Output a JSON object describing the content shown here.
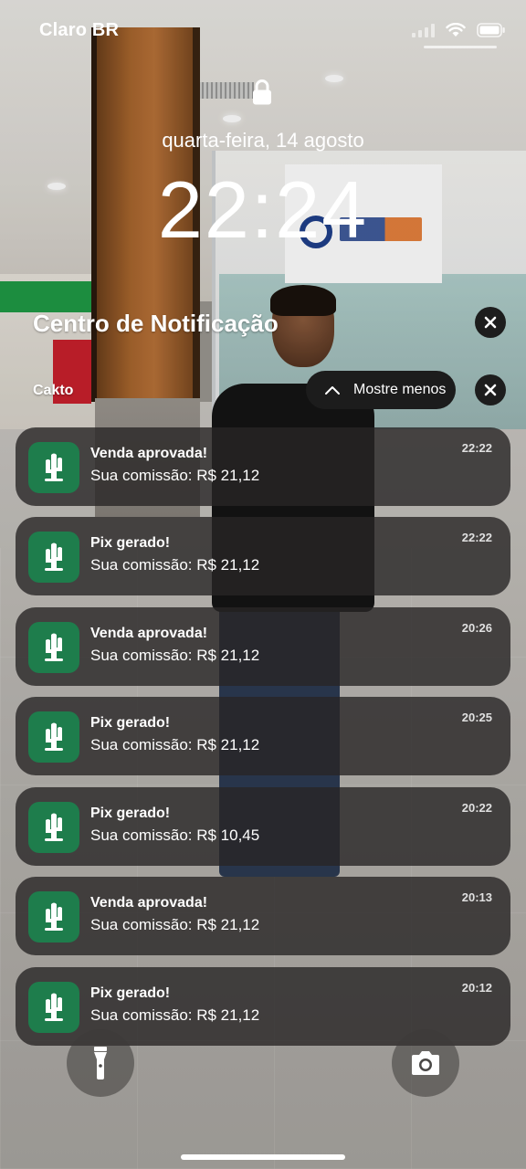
{
  "status_bar": {
    "carrier": "Claro BR",
    "icons": [
      "cellular-signal-icon",
      "wifi-icon",
      "battery-icon"
    ]
  },
  "lock_screen": {
    "lock_icon": "lock-icon",
    "date": "quarta-feira, 14 agosto",
    "time": "22:24"
  },
  "notification_center": {
    "title": "Centro de Notificação",
    "clear_all_icon": "close-icon",
    "group": {
      "app_name": "Cakto",
      "show_less_label": "Mostre menos",
      "show_less_icon": "chevron-up-icon",
      "clear_group_icon": "close-icon"
    },
    "items": [
      {
        "title": "Venda aprovada!",
        "body": "Sua comissão: R$ 21,12",
        "time": "22:22"
      },
      {
        "title": "Pix gerado!",
        "body": "Sua comissão: R$ 21,12",
        "time": "22:22"
      },
      {
        "title": "Venda aprovada!",
        "body": "Sua comissão: R$ 21,12",
        "time": "20:26"
      },
      {
        "title": "Pix gerado!",
        "body": "Sua comissão: R$ 21,12",
        "time": "20:25"
      },
      {
        "title": "Pix gerado!",
        "body": "Sua comissão: R$ 10,45",
        "time": "20:22"
      },
      {
        "title": "Venda aprovada!",
        "body": "Sua comissão: R$ 21,12",
        "time": "20:13"
      },
      {
        "title": "Pix gerado!",
        "body": "Sua comissão: R$ 21,12",
        "time": "20:12"
      }
    ]
  },
  "bottom_controls": {
    "flashlight_icon": "flashlight-icon",
    "camera_icon": "camera-icon"
  },
  "colors": {
    "app_icon_bg": "#1e7d4c",
    "notification_bg": "#282625",
    "pill_bg": "#1c1c1c"
  }
}
